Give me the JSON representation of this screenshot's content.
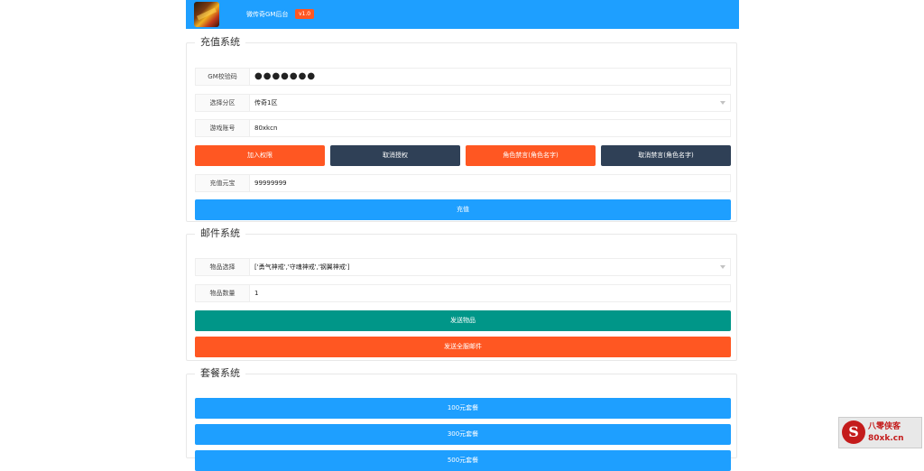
{
  "header": {
    "app_title": "微传奇GM后台",
    "version": "v1.0"
  },
  "recharge": {
    "legend": "充值系统",
    "gm_code": {
      "label": "GM校验码",
      "value": "●●●●●●●"
    },
    "zone": {
      "label": "选择分区",
      "value": "传奇1区"
    },
    "account": {
      "label": "游戏账号",
      "value": "80xkcn"
    },
    "buttons": {
      "add_permission": "加入权限",
      "cancel_permission": "取消授权",
      "mute_role": "角色禁言(角色名字)",
      "unmute_role": "取消禁言(角色名字)"
    },
    "yuanbao": {
      "label": "充值元宝",
      "value": "99999999"
    },
    "submit": "充值"
  },
  "mail": {
    "legend": "邮件系统",
    "item_select": {
      "label": "物品选择",
      "value": "['勇气神戒','守魂神戒','钢翼神戒']"
    },
    "item_count": {
      "label": "物品数量",
      "value": "1"
    },
    "send_item": "发送物品",
    "send_all": "发送全服邮件"
  },
  "package": {
    "legend": "套餐系统",
    "items": [
      "100元套餐",
      "300元套餐",
      "500元套餐"
    ]
  },
  "watermark": {
    "mark": "S",
    "name": "八零侠客",
    "url": "80xk.cn"
  },
  "colors": {
    "primary_blue": "#1e9fff",
    "orange": "#ff5722",
    "dark": "#2f4056",
    "green": "#009688"
  }
}
